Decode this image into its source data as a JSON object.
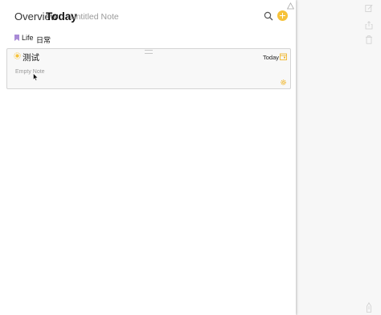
{
  "header": {
    "nav": [
      "Overview",
      "Today",
      "Untitled Note"
    ],
    "icons": {
      "search": "search-icon",
      "add": "plus-circle-icon",
      "corner": "warning-icon"
    },
    "accent_color": "#f6c23a"
  },
  "tags": [
    {
      "label": "Life",
      "icon": "bookmark-icon",
      "color": "#a98bd6"
    },
    {
      "label": "日常"
    }
  ],
  "card": {
    "title": "测试",
    "date": "Today",
    "body": "Empty Note",
    "icons": {
      "left": "sun-icon",
      "right_top": "calendar-icon",
      "right_bottom": "gear-icon"
    }
  },
  "side_toolbar": [
    "edit-icon",
    "share-icon",
    "trash-icon",
    "pen-icon"
  ]
}
